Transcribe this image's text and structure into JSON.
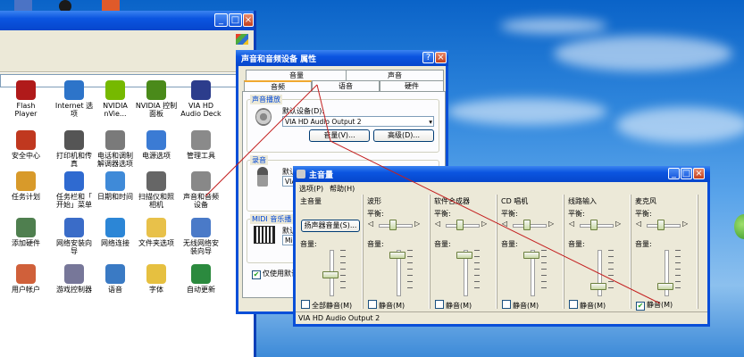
{
  "control_panel": {
    "items": [
      {
        "label": "Flash\nPlayer",
        "icon": "flash-icon",
        "color": "#b01a1a"
      },
      {
        "label": "Internet 选\n项",
        "icon": "internet-options-icon",
        "color": "#2d74c9"
      },
      {
        "label": "NVIDIA\nnVie...",
        "icon": "nvidia-icon",
        "color": "#76b900"
      },
      {
        "label": "NVIDIA 控制\n面板",
        "icon": "nvidia-panel-icon",
        "color": "#4a8a1a"
      },
      {
        "label": "VIA HD\nAudio Deck",
        "icon": "via-audio-icon",
        "color": "#2c3d8c"
      },
      {
        "label": "安全中心",
        "icon": "security-center-icon",
        "color": "#c0381f"
      },
      {
        "label": "打印机和传\n真",
        "icon": "printer-icon",
        "color": "#555555"
      },
      {
        "label": "电话和调制\n解调器选项",
        "icon": "phone-modem-icon",
        "color": "#7a7a7a"
      },
      {
        "label": "电源选项",
        "icon": "power-options-icon",
        "color": "#3b7bd4"
      },
      {
        "label": "管理工具",
        "icon": "admin-tools-icon",
        "color": "#8a8a8a"
      },
      {
        "label": "任务计划",
        "icon": "scheduled-tasks-icon",
        "color": "#d89a2a"
      },
      {
        "label": "任务栏和「\n开始」菜单",
        "icon": "taskbar-icon",
        "color": "#2f6ad0"
      },
      {
        "label": "日期和时间",
        "icon": "date-time-icon",
        "color": "#3f8ad8"
      },
      {
        "label": "扫描仪和照\n相机",
        "icon": "scanner-icon",
        "color": "#666666"
      },
      {
        "label": "声音和音频\n设备",
        "icon": "sound-devices-icon",
        "color": "#888888"
      },
      {
        "label": "添加硬件",
        "icon": "add-hardware-icon",
        "color": "#4f7f4f"
      },
      {
        "label": "网络安装向\n导",
        "icon": "network-setup-icon",
        "color": "#3a6cc8"
      },
      {
        "label": "网络连接",
        "icon": "network-connections-icon",
        "color": "#2c86d6"
      },
      {
        "label": "文件夹选项",
        "icon": "folder-options-icon",
        "color": "#e8c14a"
      },
      {
        "label": "无线网络安\n装向导",
        "icon": "wireless-setup-icon",
        "color": "#4a7ac8"
      },
      {
        "label": "用户帐户",
        "icon": "user-accounts-icon",
        "color": "#d0603a"
      },
      {
        "label": "游戏控制器",
        "icon": "game-controller-icon",
        "color": "#777799"
      },
      {
        "label": "语音",
        "icon": "speech-icon",
        "color": "#3a7ac4"
      },
      {
        "label": "字体",
        "icon": "fonts-icon",
        "color": "#e6c040"
      },
      {
        "label": "自动更新",
        "icon": "auto-update-icon",
        "color": "#2b8a3e"
      }
    ]
  },
  "props_dialog": {
    "title": "声音和音频设备 属性",
    "tabs_row1": [
      "音量",
      "声音"
    ],
    "tabs_row2": [
      "音频",
      "语音",
      "硬件"
    ],
    "playback_group": "声音播放",
    "default_device_label": "默认设备(D):",
    "playback_device": "VIA HD Audio Output 2",
    "volume_button": "音量(V)...",
    "advanced_button": "高级(D)...",
    "record_group": "录音",
    "record_default_label": "默认",
    "record_device": "VIA",
    "midi_group": "MIDI 音乐播",
    "midi_default_label": "默认",
    "midi_device": "Mic",
    "use_default_label": "仅使用默认"
  },
  "master_volume": {
    "title": "主音量",
    "menu": [
      "选项(P)",
      "帮助(H)"
    ],
    "status": "VIA HD Audio Output 2",
    "balance_label": "平衡:",
    "volume_label": "音量:",
    "mute_label": "静音(M)",
    "mute_all_label": "全部静音(M)",
    "speaker_button": "扬声器音量(S)...",
    "channels": [
      {
        "name": "主音量",
        "volume_level": 0.45,
        "muted": false
      },
      {
        "name": "波形",
        "volume_level": 0.95,
        "muted": false
      },
      {
        "name": "软件合成器",
        "volume_level": 0.95,
        "muted": false
      },
      {
        "name": "CD 唱机",
        "volume_level": 0.95,
        "muted": false
      },
      {
        "name": "线路输入",
        "volume_level": 0.15,
        "muted": false
      },
      {
        "name": "麦克风",
        "volume_level": 0.15,
        "muted": true
      }
    ]
  },
  "colors": {
    "title_blue": "#0b55e0",
    "dialog_bg": "#ece9d8",
    "link_line": "#c42020"
  }
}
